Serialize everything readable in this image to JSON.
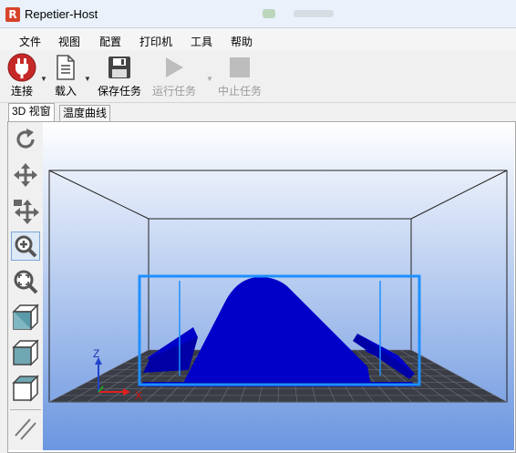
{
  "window": {
    "title": "Repetier-Host",
    "app_icon": "R"
  },
  "menu": {
    "items": [
      "文件",
      "视图",
      "配置",
      "打印机",
      "工具",
      "帮助"
    ]
  },
  "toolbar": {
    "connect": "连接",
    "load": "载入",
    "save_job": "保存任务",
    "run_job": "运行任务",
    "stop_job": "中止任务"
  },
  "tabs": [
    {
      "label": "3D 视窗",
      "active": true
    },
    {
      "label": "温度曲线",
      "active": false
    }
  ],
  "side_tools": [
    "refresh-icon",
    "move-icon",
    "move-object-icon",
    "zoom-in-icon",
    "zoom-fit-icon",
    "view-iso-cube-icon",
    "view-front-cube-icon",
    "view-top-cube-icon",
    "parallel-lines-icon"
  ],
  "axes": {
    "z": "Z",
    "x": "X"
  },
  "colors": {
    "model": "#0000c8",
    "build_box": "#1e90ff",
    "bg_top": "#ffffff",
    "bg_bottom": "#6b96e0",
    "connect_red": "#c62828"
  }
}
